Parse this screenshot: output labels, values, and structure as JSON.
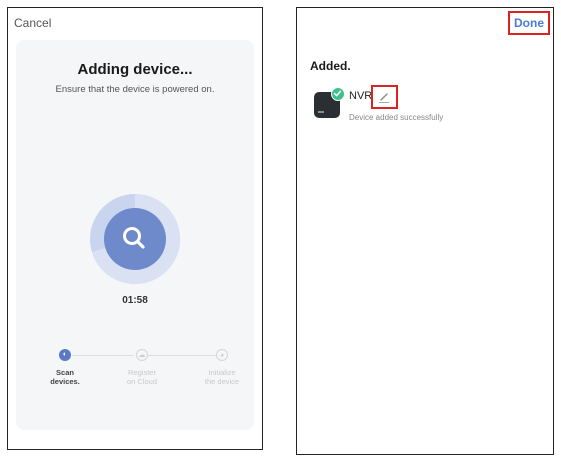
{
  "left_screen": {
    "cancel_label": "Cancel",
    "title": "Adding device...",
    "subtitle": "Ensure that the device is powered on.",
    "timer": "01:58",
    "steps": [
      {
        "line1": "Scan",
        "line2": "devices.",
        "state": "active"
      },
      {
        "line1": "Register",
        "line2": "on Cloud",
        "state": "inactive"
      },
      {
        "line1": "Initialize",
        "line2": "the device",
        "state": "inactive"
      }
    ],
    "icons": {
      "search": "search-icon",
      "step_scan": "scan-icon",
      "step_cloud": "cloud-icon",
      "step_init": "init-icon"
    }
  },
  "right_screen": {
    "done_label": "Done",
    "added_heading": "Added.",
    "device": {
      "name": "NVR",
      "status": "Device added successfully",
      "icons": {
        "device": "nvr-device-icon",
        "check": "check-badge-icon",
        "edit": "pencil-icon"
      }
    }
  },
  "colors": {
    "accent_blue": "#5b79c4",
    "ring_outer": "#c9d4ee",
    "ring_inner": "#6f8acb",
    "done_blue": "#4b7bd6",
    "highlight_red": "#dd2222",
    "success_green": "#3fbf8c"
  }
}
